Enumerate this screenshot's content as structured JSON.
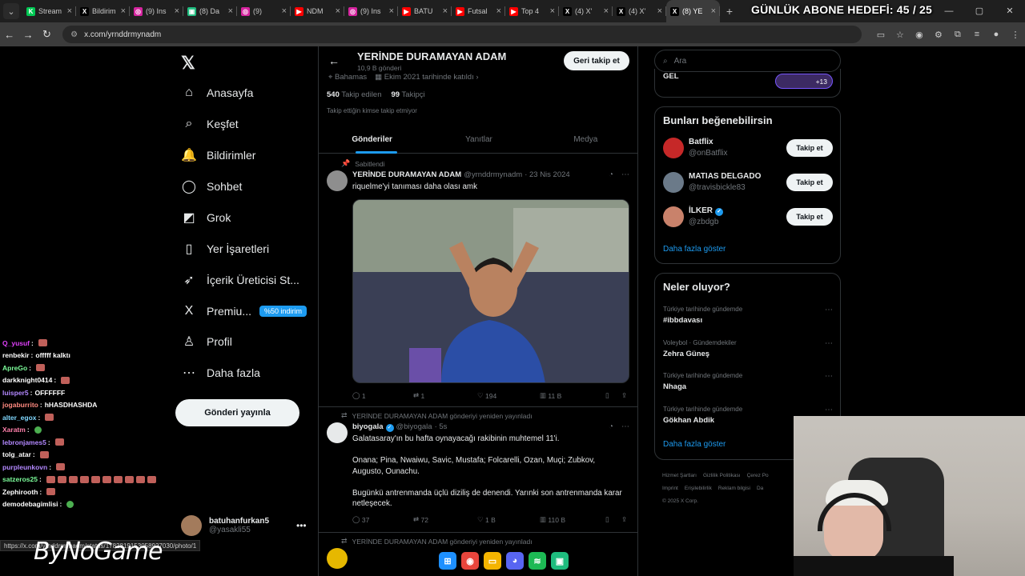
{
  "browser": {
    "tabs": [
      {
        "label": "Stream",
        "color": "#00c853",
        "glyph": "K"
      },
      {
        "label": "Bildirim",
        "color": "#000000",
        "glyph": "X"
      },
      {
        "label": "(9) Ins",
        "color": "#d6249f",
        "glyph": "◎"
      },
      {
        "label": "(8) Da",
        "color": "#1ebc7e",
        "glyph": "▣"
      },
      {
        "label": "(9)",
        "color": "#d6249f",
        "glyph": "◎"
      },
      {
        "label": "NDM",
        "color": "#ff0000",
        "glyph": "▶"
      },
      {
        "label": "(9) Ins",
        "color": "#d6249f",
        "glyph": "◎"
      },
      {
        "label": "BATU",
        "color": "#ff0000",
        "glyph": "▶"
      },
      {
        "label": "Futsal",
        "color": "#ff0000",
        "glyph": "▶"
      },
      {
        "label": "Top 4",
        "color": "#ff0000",
        "glyph": "▶"
      },
      {
        "label": "(4) X'",
        "color": "#000000",
        "glyph": "X"
      },
      {
        "label": "(4) X'",
        "color": "#000000",
        "glyph": "X"
      },
      {
        "label": "(8) YE",
        "color": "#000000",
        "glyph": "X"
      }
    ],
    "url": "x.com/yrnddrmynadm",
    "status_url": "https://x.com/yrnddrmynadm/status/1782819153058927030/photo/1"
  },
  "overlay": {
    "goal": "GÜNLÜK ABONE HEDEFİ: 45 / 25",
    "watermark": "ByNoGame"
  },
  "sidebar": {
    "items": [
      {
        "label": "Anasayfa",
        "icon": "⌂"
      },
      {
        "label": "Keşfet",
        "icon": "⌕"
      },
      {
        "label": "Bildirimler",
        "icon": "🔔"
      },
      {
        "label": "Sohbet",
        "icon": "◯"
      },
      {
        "label": "Grok",
        "icon": "◩"
      },
      {
        "label": "Yer İşaretleri",
        "icon": "▯"
      },
      {
        "label": "İçerik Üreticisi St...",
        "icon": "➶"
      },
      {
        "label": "Premiu...",
        "icon": "X"
      },
      {
        "label": "Profil",
        "icon": "♙"
      },
      {
        "label": "Daha fazla",
        "icon": "⋯"
      }
    ],
    "premium_badge": "%50 indirim",
    "post_button": "Gönderi yayınla",
    "account": {
      "name": "batuhanfurkan5",
      "handle": "@yasakli55"
    }
  },
  "chat": [
    {
      "user": "Q_yusuf",
      "msg": "",
      "color": "#e040fb",
      "emotes": 1
    },
    {
      "user": "renbekir",
      "msg": "offfff kalktı",
      "color": "#ffffff",
      "emotes": 0
    },
    {
      "user": "ApreGo",
      "msg": "",
      "color": "#7cfc9a",
      "emotes": 1
    },
    {
      "user": "darkknight0414",
      "msg": "",
      "color": "#ffffff",
      "emotes": 1
    },
    {
      "user": "luisper5",
      "msg": "OFFFFFF",
      "color": "#b388ff",
      "emotes": 0
    },
    {
      "user": "jogaburrito",
      "msg": "hHASDHASHDA",
      "color": "#ff8a80",
      "emotes": 0
    },
    {
      "user": "alter_egox",
      "msg": "",
      "color": "#80d8ff",
      "emotes": 1
    },
    {
      "user": "Xaratm",
      "msg": "",
      "color": "#ff80ab",
      "emotes": 1
    },
    {
      "user": "lebronjames5",
      "msg": "",
      "color": "#b388ff",
      "emotes": 1
    },
    {
      "user": "tolg_atar",
      "msg": "",
      "color": "#ffffff",
      "emotes": 1
    },
    {
      "user": "purpleunkovn",
      "msg": "",
      "color": "#b388ff",
      "emotes": 1
    },
    {
      "user": "satzeros25",
      "msg": "",
      "color": "#7cfc9a",
      "emotes": 10
    },
    {
      "user": "Zephirooth",
      "msg": "",
      "color": "#ffffff",
      "emotes": 1
    },
    {
      "user": "demodebagimlisi",
      "msg": "",
      "color": "#ffffff",
      "emotes": 1
    }
  ],
  "profile": {
    "name": "YERİNDE DURAMAYAN ADAM",
    "posts_count": "10,9 B gönderi",
    "follow_button": "Geri takip et",
    "location": "Bahamas",
    "joined": "Ekim 2021 tarihinde katıldı",
    "following_count": "540",
    "following_label": "Takip edilen",
    "followers_count": "99",
    "followers_label": "Takipçi",
    "not_followed_note": "Takip ettiğin kimse takip etmiyor",
    "tabs": [
      "Gönderiler",
      "Yanıtlar",
      "Medya"
    ]
  },
  "tweets": [
    {
      "context": "Sabitlendi",
      "name": "YERİNDE DURAMAYAN ADAM",
      "handle": "@yrnddrmynadm",
      "time": "· 23 Nis 2024",
      "text": "riquelme'yi tanıması daha olası amk",
      "replies": "1",
      "reposts": "1",
      "likes": "194",
      "views": "11 B"
    },
    {
      "context": "YERİNDE DURAMAYAN ADAM gönderiyi yeniden yayınladı",
      "name": "biyogala",
      "handle": "@biyogala",
      "time": "· 5s",
      "text": "Galatasaray'ın bu hafta oynayacağı rakibinin muhtemel 11'i.\n\nOnana; Pina, Nwaiwu, Savic, Mustafa; Folcarelli, Ozan, Muçi; Zubkov, Augusto, Ounachu.\n\nBugünkü antrenmanda üçlü diziliş de denendi. Yarınki son antrenmanda karar netleşecek.",
      "replies": "37",
      "reposts": "72",
      "likes": "1 B",
      "views": "110 B"
    },
    {
      "context": "YERİNDE DURAMAYAN ADAM gönderiyi yeniden yayınladı"
    }
  ],
  "right": {
    "search_placeholder": "Ara",
    "space_title": "GEL",
    "space_count": "+13",
    "suggest_title": "Bunları beğenebilirsin",
    "suggestions": [
      {
        "name": "Batflix",
        "handle": "@onBatflix",
        "button": "Takip et",
        "color": "#c62828",
        "verified": false
      },
      {
        "name": "MATIAS DELGADO",
        "handle": "@travisbickle83",
        "button": "Takip et",
        "color": "#6b7a89",
        "verified": false
      },
      {
        "name": "İLKER",
        "handle": "@zbdgb",
        "button": "Takip et",
        "color": "#c9826b",
        "verified": true
      }
    ],
    "show_more": "Daha fazla göster",
    "trends_title": "Neler oluyor?",
    "trends": [
      {
        "context": "Türkiye tarihinde gündemde",
        "name": "#ibbdavası"
      },
      {
        "context": "Voleybol · Gündemdekiler",
        "name": "Zehra Güneş"
      },
      {
        "context": "Türkiye tarihinde gündemde",
        "name": "Nhaga"
      },
      {
        "context": "Türkiye tarihinde gündemde",
        "name": "Gökhan Abdik"
      }
    ],
    "footer": [
      "Hizmet Şartları",
      "Gizlilik Politikası",
      "Çerez Po",
      "Imprint",
      "Erişilebilirlik",
      "Reklam bilgisi",
      "Da",
      "© 2025 X Corp."
    ]
  },
  "taskbar": [
    {
      "name": "windows-start",
      "color": "#1e90ff",
      "glyph": "⊞"
    },
    {
      "name": "chrome",
      "color": "#e8453c",
      "glyph": "◉"
    },
    {
      "name": "file-explorer",
      "color": "#f4b400",
      "glyph": "▭"
    },
    {
      "name": "discord",
      "color": "#5865f2",
      "glyph": "◕"
    },
    {
      "name": "spotify",
      "color": "#1db954",
      "glyph": "≋"
    },
    {
      "name": "app-green",
      "color": "#1ebc7e",
      "glyph": "▣"
    }
  ]
}
